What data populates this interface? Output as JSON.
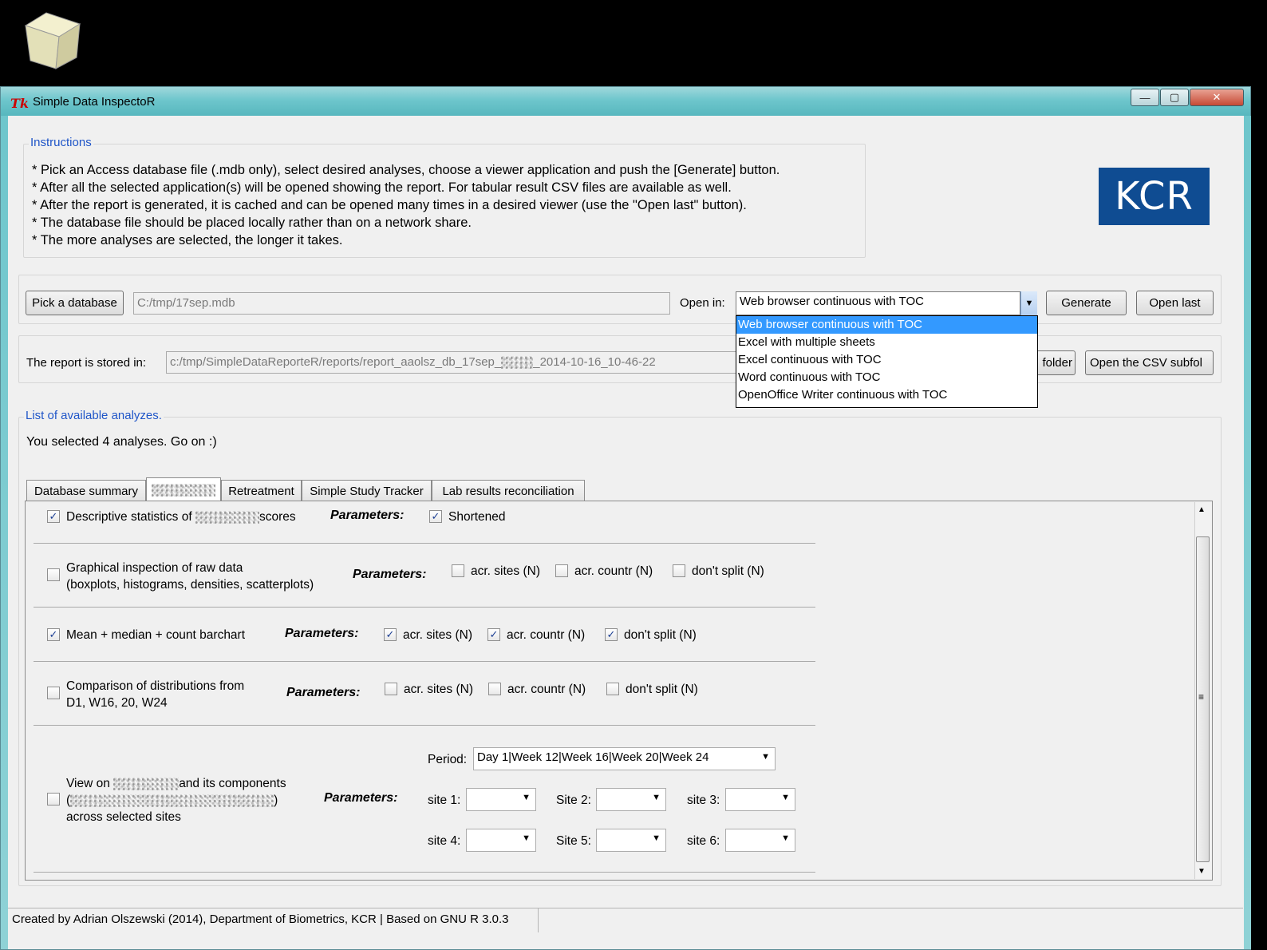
{
  "window": {
    "title": "Simple Data InspectoR",
    "app_icon": "Tk",
    "minimize_glyph": "—",
    "maximize_glyph": "▢",
    "close_glyph": "✕"
  },
  "instructions": {
    "title": "Instructions",
    "lines": [
      "* Pick an Access database file (.mdb only), select desired analyses, choose a viewer application and push the [Generate] button.",
      "* After all the selected application(s) will be opened showing the report. For tabular result CSV files are available as well.",
      "* After the report is generated, it is cached and can be opened many times in a desired viewer (use the \"Open last\" button).",
      "* The database file should be placed locally rather than on a network share.",
      "* The more analyses are selected, the longer it takes."
    ]
  },
  "logo": {
    "text": "KCR",
    "color": "#0f4c92"
  },
  "database": {
    "pick_button": "Pick a database",
    "path": "C:/tmp/17sep.mdb",
    "open_in_label": "Open in:",
    "open_in_value": "Web browser continuous with TOC",
    "generate_button": "Generate",
    "open_last_button": "Open last",
    "open_in_options": [
      "Web browser continuous with TOC",
      "Excel with multiple sheets",
      "Excel continuous with TOC",
      "Word continuous with TOC",
      "OpenOffice Writer continuous with TOC"
    ]
  },
  "report": {
    "label": "The report is stored in:",
    "path_prefix": "c:/tmp/SimpleDataReporteR/reports/report_aaolsz_db_17sep_",
    "path_suffix": "_2014-10-16_10-46-22",
    "open_folder_button": "folder",
    "open_csv_button": "Open the CSV subfol"
  },
  "analyses": {
    "title": "List of available analyzes.",
    "status": "You selected 4 analyses. Go on :)",
    "tabs": [
      "Database summary",
      "",
      "Retreatment",
      "Simple Study Tracker",
      "Lab results reconciliation"
    ],
    "params_label": "Parameters:",
    "rows": [
      {
        "label_a": "Descriptive statistics of",
        "label_b": "scores",
        "checked": true,
        "params": [
          {
            "label": "Shortened",
            "checked": true
          }
        ]
      },
      {
        "label_line1": "Graphical inspection of raw data",
        "label_line2": "(boxplots, histograms, densities, scatterplots)",
        "checked": false,
        "params": [
          {
            "label": "acr. sites (N)",
            "checked": false
          },
          {
            "label": "acr. countr (N)",
            "checked": false
          },
          {
            "label": "don't split (N)",
            "checked": false
          }
        ]
      },
      {
        "label": "Mean + median + count barchart",
        "checked": true,
        "params": [
          {
            "label": "acr. sites (N)",
            "checked": true
          },
          {
            "label": "acr. countr (N)",
            "checked": true
          },
          {
            "label": "don't split (N)",
            "checked": true
          }
        ]
      },
      {
        "label_line1": "Comparison of distributions from",
        "label_line2": "D1, W16, 20, W24",
        "checked": false,
        "params": [
          {
            "label": "acr. sites (N)",
            "checked": false
          },
          {
            "label": "acr. countr (N)",
            "checked": false
          },
          {
            "label": "don't split (N)",
            "checked": false
          }
        ]
      },
      {
        "label_line1a": "View on",
        "label_line1b": "and its components",
        "label_line2a": "(",
        "label_line2b": ")",
        "label_line3": "across selected sites",
        "checked": false,
        "period_label": "Period:",
        "period_value": "Day 1|Week 12|Week 16|Week 20|Week 24",
        "sites": [
          "site 1:",
          "Site 2:",
          "site 3:",
          "site 4:",
          "Site 5:",
          "site 6:"
        ]
      }
    ]
  },
  "checkmark": "✓",
  "status_bar": "Created by Adrian Olszewski (2014), Department of Biometrics, KCR | Based on GNU R 3.0.3"
}
